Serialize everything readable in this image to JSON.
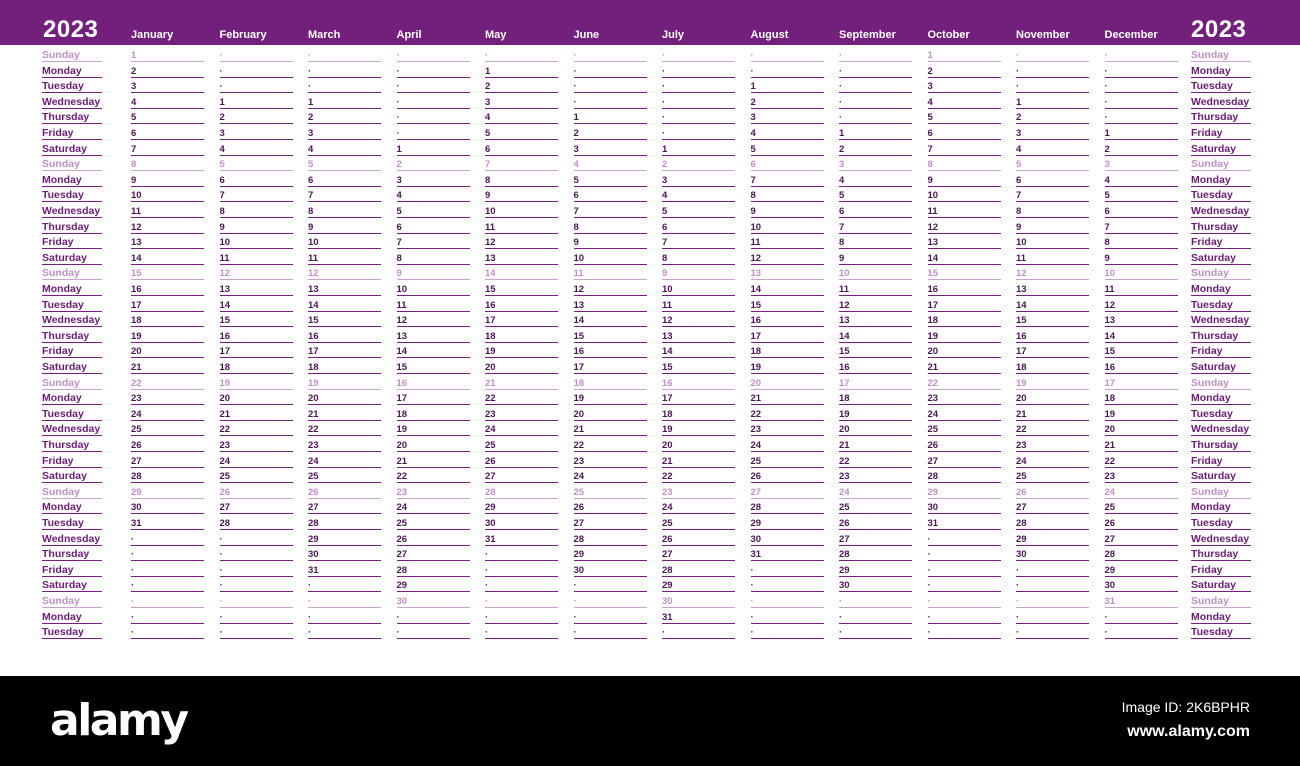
{
  "calendar": {
    "year": "2023",
    "colors": {
      "header": "#73207d",
      "weekday_text": "#4a1553",
      "sunday_text": "#c08fc8",
      "line": "#73207d"
    },
    "weekdays": [
      "Sunday",
      "Monday",
      "Tuesday",
      "Wednesday",
      "Thursday",
      "Friday",
      "Saturday",
      "Sunday",
      "Monday",
      "Tuesday",
      "Wednesday",
      "Thursday",
      "Friday",
      "Saturday",
      "Sunday",
      "Monday",
      "Tuesday",
      "Wednesday",
      "Thursday",
      "Friday",
      "Saturday",
      "Sunday",
      "Monday",
      "Tuesday",
      "Wednesday",
      "Thursday",
      "Friday",
      "Saturday",
      "Sunday",
      "Monday",
      "Tuesday",
      "Wednesday",
      "Thursday",
      "Friday",
      "Saturday",
      "Sunday",
      "Monday",
      "Tuesday"
    ],
    "months": [
      {
        "name": "January",
        "days_in_month": 31,
        "first_row": 0
      },
      {
        "name": "February",
        "days_in_month": 28,
        "first_row": 3
      },
      {
        "name": "March",
        "days_in_month": 31,
        "first_row": 3
      },
      {
        "name": "April",
        "days_in_month": 30,
        "first_row": 6
      },
      {
        "name": "May",
        "days_in_month": 31,
        "first_row": 1
      },
      {
        "name": "June",
        "days_in_month": 30,
        "first_row": 4
      },
      {
        "name": "July",
        "days_in_month": 31,
        "first_row": 6
      },
      {
        "name": "August",
        "days_in_month": 31,
        "first_row": 2
      },
      {
        "name": "September",
        "days_in_month": 30,
        "first_row": 5
      },
      {
        "name": "October",
        "days_in_month": 31,
        "first_row": 0
      },
      {
        "name": "November",
        "days_in_month": 30,
        "first_row": 3
      },
      {
        "name": "December",
        "days_in_month": 31,
        "first_row": 5
      }
    ],
    "empty_marker": "·"
  },
  "footer": {
    "logo": "alamy",
    "image_id": "Image ID: 2K6BPHR",
    "url": "www.alamy.com"
  }
}
